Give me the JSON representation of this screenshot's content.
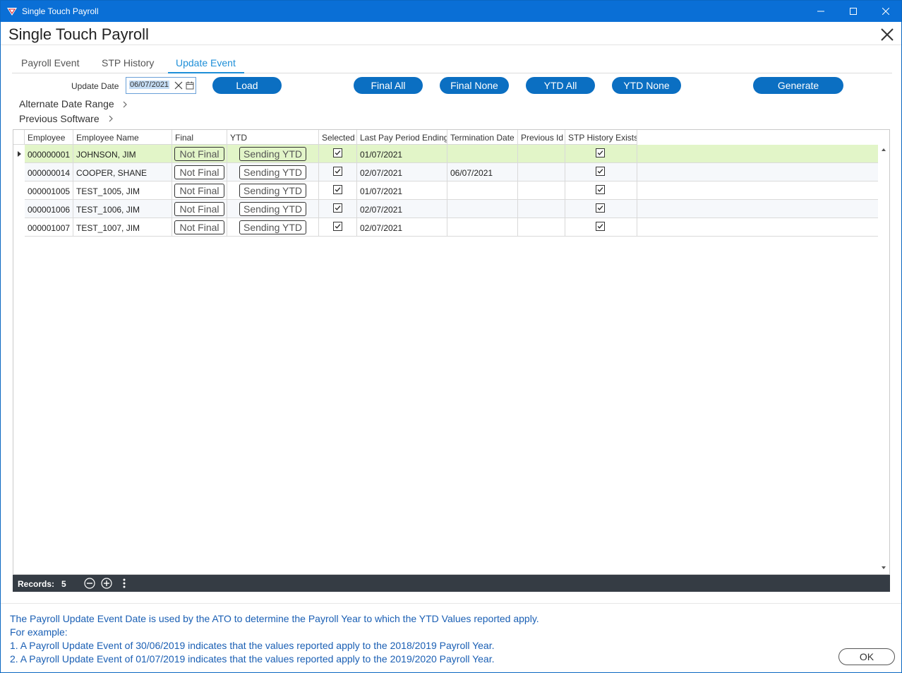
{
  "window": {
    "title": "Single Touch Payroll"
  },
  "header": {
    "title": "Single Touch Payroll"
  },
  "tabs": [
    {
      "label": "Payroll Event"
    },
    {
      "label": "STP History"
    },
    {
      "label": "Update Event",
      "active": true
    }
  ],
  "toolbar": {
    "date_label": "Update Date",
    "date_value": "06/07/2021",
    "load_label": "Load",
    "final_all_label": "Final All",
    "final_none_label": "Final None",
    "ytd_all_label": "YTD All",
    "ytd_none_label": "YTD None",
    "generate_label": "Generate"
  },
  "links": {
    "alternate_date_range": "Alternate Date Range",
    "previous_software": "Previous Software"
  },
  "grid": {
    "columns": [
      "Employee",
      "Employee Name",
      "Final",
      "YTD",
      "Selected",
      "Last Pay Period Ending",
      "Termination Date",
      "Previous Id",
      "STP History Exists"
    ],
    "rows": [
      {
        "employee": "000000001",
        "name": "JOHNSON, JIM",
        "final": "Not Final",
        "ytd": "Sending YTD",
        "selected": true,
        "last_pay": "01/07/2021",
        "termination": "",
        "previous_id": "",
        "stp_history": true
      },
      {
        "employee": "000000014",
        "name": "COOPER, SHANE",
        "final": "Not Final",
        "ytd": "Sending YTD",
        "selected": true,
        "last_pay": "02/07/2021",
        "termination": "06/07/2021",
        "previous_id": "",
        "stp_history": true
      },
      {
        "employee": "000001005",
        "name": "TEST_1005, JIM",
        "final": "Not Final",
        "ytd": "Sending YTD",
        "selected": true,
        "last_pay": "01/07/2021",
        "termination": "",
        "previous_id": "",
        "stp_history": true
      },
      {
        "employee": "000001006",
        "name": "TEST_1006, JIM",
        "final": "Not Final",
        "ytd": "Sending YTD",
        "selected": true,
        "last_pay": "02/07/2021",
        "termination": "",
        "previous_id": "",
        "stp_history": true
      },
      {
        "employee": "000001007",
        "name": "TEST_1007, JIM",
        "final": "Not Final",
        "ytd": "Sending YTD",
        "selected": true,
        "last_pay": "02/07/2021",
        "termination": "",
        "previous_id": "",
        "stp_history": true
      }
    ]
  },
  "footer": {
    "records_label": "Records:",
    "records_count": "5"
  },
  "info": {
    "line1": "The Payroll Update Event Date is used by the ATO to determine the Payroll Year to which the YTD Values reported apply.",
    "line2": "For example:",
    "line3": "1. A Payroll Update Event of 30/06/2019 indicates that the values reported apply to the 2018/2019 Payroll Year.",
    "line4": "2. A Payroll Update Event of 01/07/2019 indicates that the values reported apply to the 2019/2020 Payroll Year."
  },
  "ok_label": "OK",
  "colors": {
    "accent": "#0b6fc2",
    "titlebar": "#0a6fd6",
    "selected_row": "#e2f5c8",
    "footer_bar": "#353c44",
    "info_text": "#1a5fb4"
  }
}
